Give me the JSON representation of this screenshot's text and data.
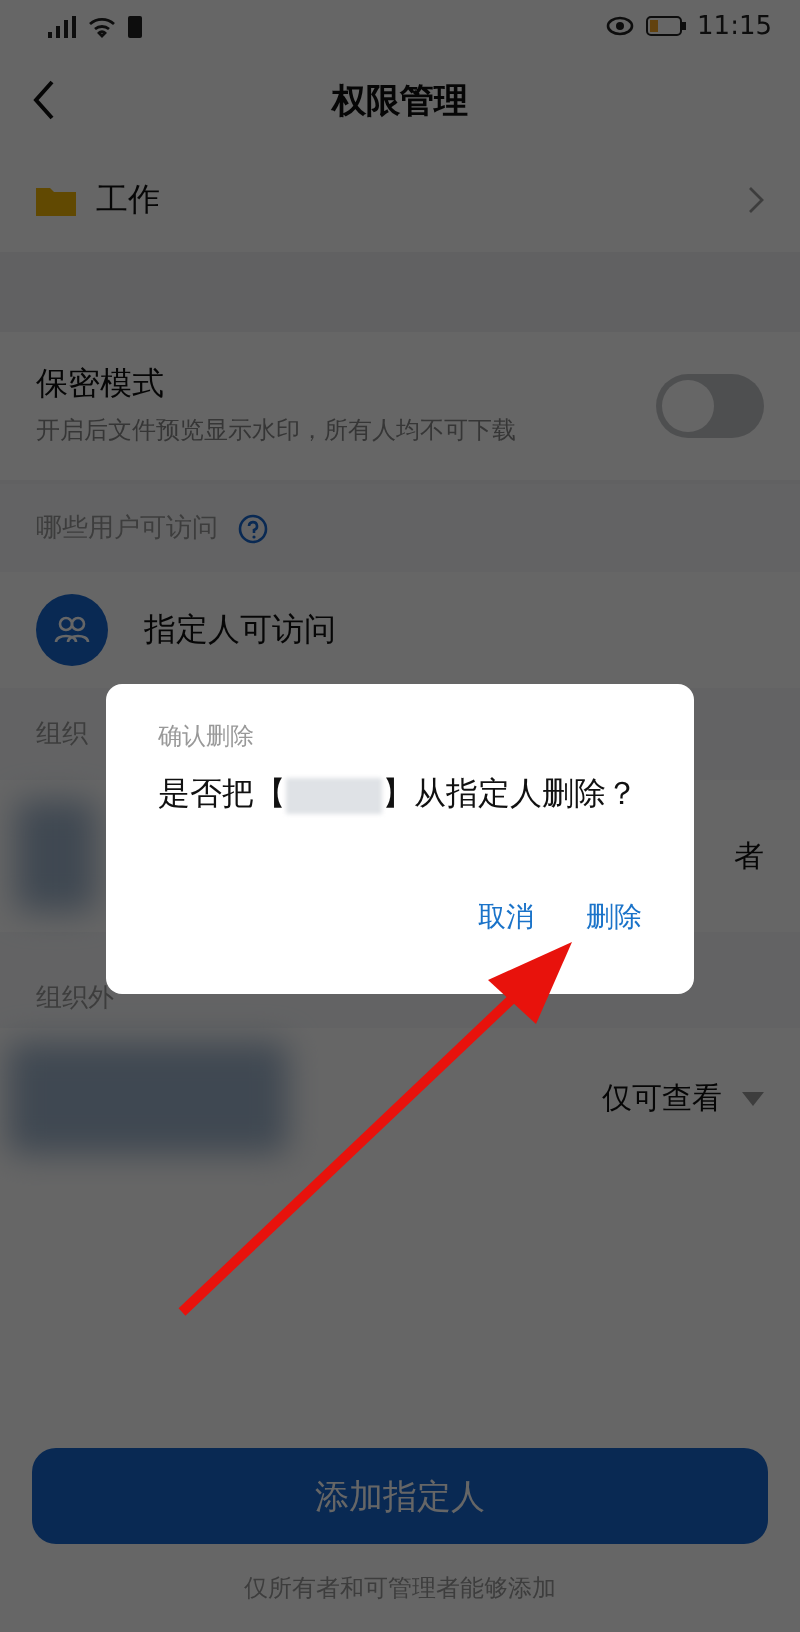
{
  "status_bar": {
    "time": "11:15"
  },
  "header": {
    "title": "权限管理"
  },
  "folder": {
    "name": "工作"
  },
  "secure_mode": {
    "title": "保密模式",
    "description": "开启后文件预览显示水印，所有人均不可下载",
    "on": false
  },
  "access": {
    "label": "哪些用户可访问",
    "option": "指定人可访问"
  },
  "inside_group": {
    "label": "组织",
    "permission": "者"
  },
  "outside_group": {
    "label": "组织外",
    "permission": "仅可查看"
  },
  "add_button": {
    "label": "添加指定人"
  },
  "footer_note": "仅所有者和可管理者能够添加",
  "dialog": {
    "title": "确认删除",
    "message_start": "是否把【",
    "message_end": "】从指定人删除？",
    "buttons": [
      "取消",
      "删除"
    ]
  }
}
